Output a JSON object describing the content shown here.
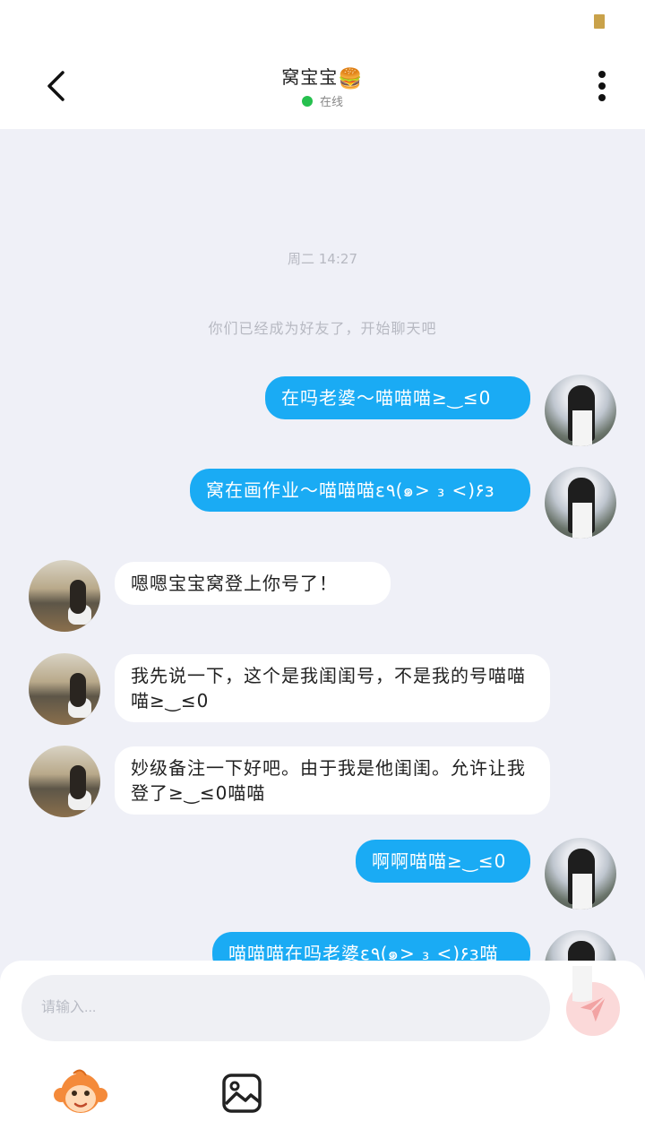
{
  "header": {
    "title": "窝宝宝",
    "title_emoji": "🍔",
    "status": "在线",
    "status_color": "#26c04e"
  },
  "chat": {
    "timestamp": "周二 14:27",
    "system_notice": "你们已经成为好友了，开始聊天吧",
    "messages": [
      {
        "from": "me",
        "text": "在吗老婆～喵喵喵≥‿≤0"
      },
      {
        "from": "me",
        "text": "窝在画作业～喵喵喵ε٩(๑> ₃ <)۶з"
      },
      {
        "from": "them",
        "text": "嗯嗯宝宝窝登上你号了！"
      },
      {
        "from": "them",
        "text": "我先说一下，这个是我闺闺号，不是我的号喵喵喵≥‿≤0"
      },
      {
        "from": "them",
        "text": "妙级备注一下好吧。由于我是他闺闺。允许让我登了≥‿≤0喵喵"
      },
      {
        "from": "me",
        "text": "啊啊喵喵≥‿≤0"
      },
      {
        "from": "me",
        "text": "喵喵喵在吗老婆ε٩(๑> ₃ <)۶з喵"
      }
    ]
  },
  "composer": {
    "placeholder": "请输入...",
    "send_icon": "paper-plane-icon",
    "emoji_icon": "monkey-sticker-icon",
    "image_icon": "image-icon"
  },
  "colors": {
    "my_bubble": "#1aabf4",
    "their_bubble": "#ffffff",
    "background": "#eff0f7",
    "send_button_disabled": "#fbd9d9"
  }
}
